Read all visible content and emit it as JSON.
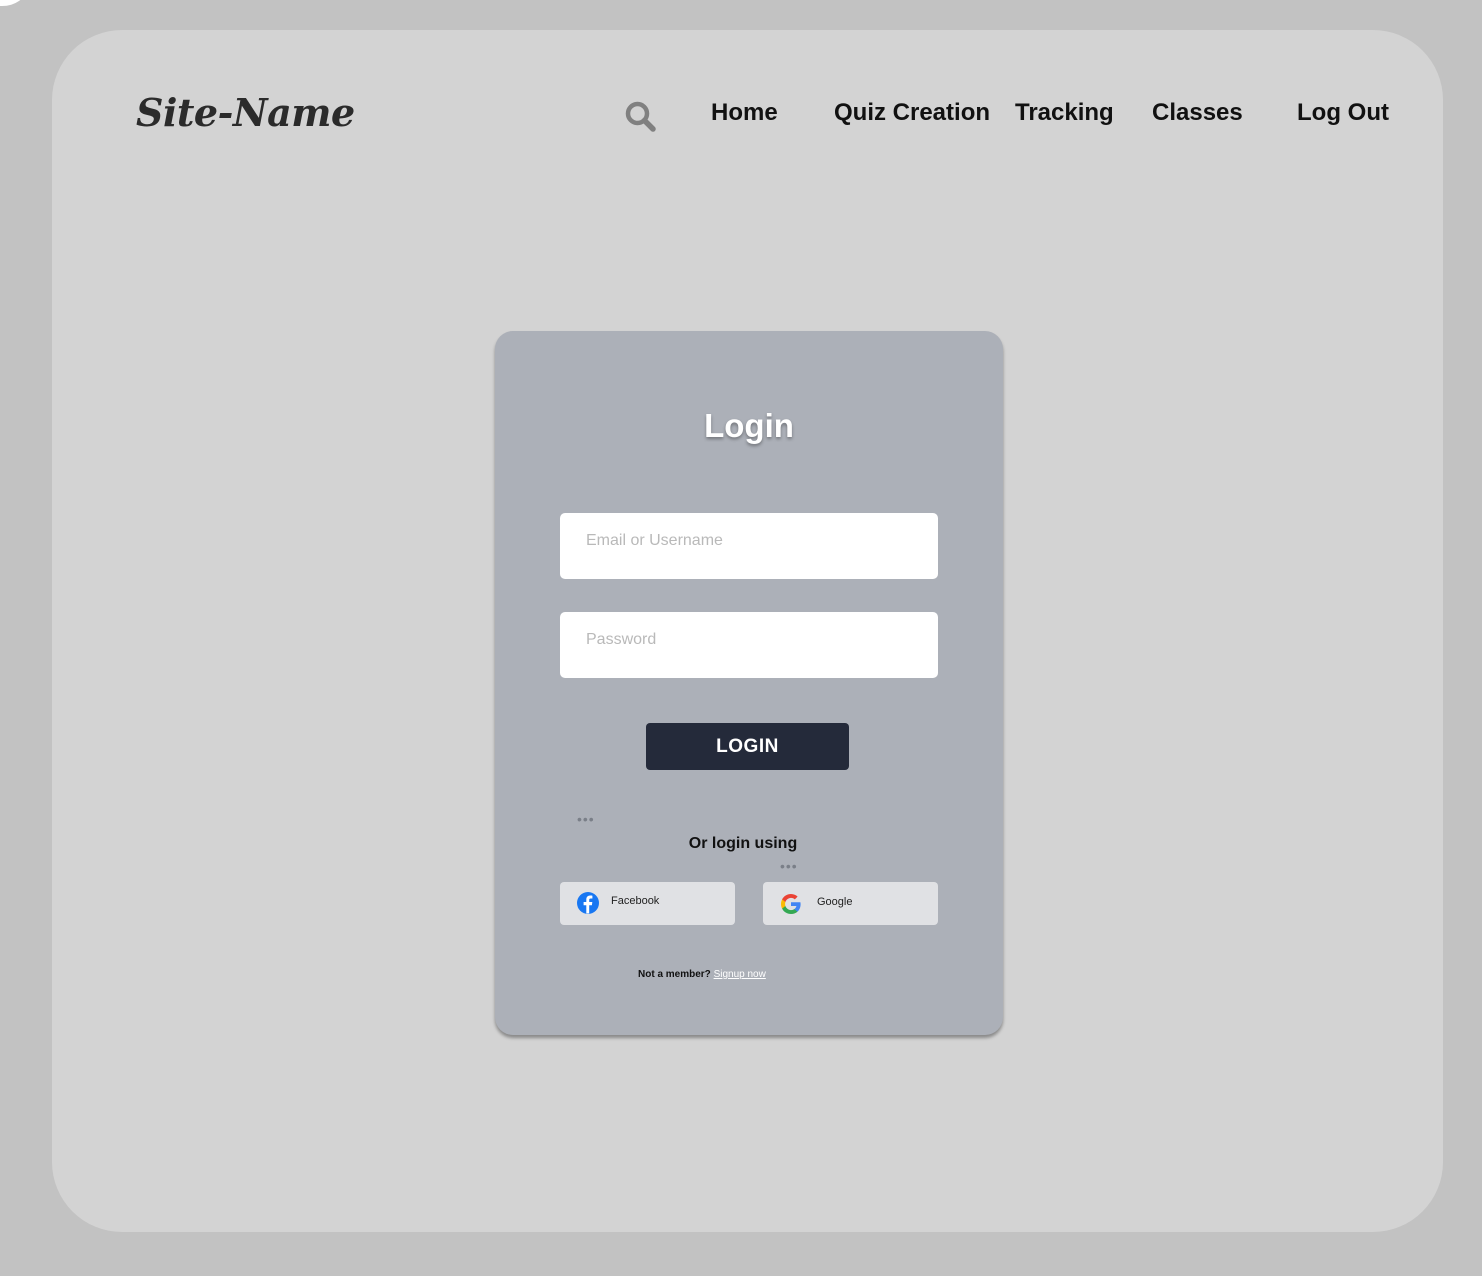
{
  "brand": {
    "name": "Site-Name"
  },
  "nav": {
    "items": [
      {
        "label": "Home"
      },
      {
        "label": "Quiz Creation"
      },
      {
        "label": "Tracking"
      },
      {
        "label": "Classes"
      },
      {
        "label": "Log Out"
      }
    ],
    "search_icon": "search-icon"
  },
  "login": {
    "title": "Login",
    "username_placeholder": "Email or Username",
    "password_placeholder": "Password",
    "button_label": "LOGIN",
    "alt_text": "Or login using",
    "social": [
      {
        "label": "Facebook",
        "icon": "facebook-icon"
      },
      {
        "label": "Google",
        "icon": "google-icon"
      }
    ],
    "signup_prompt": "Not a member?",
    "signup_link": "Signup now"
  },
  "colors": {
    "page_bg": "#c2c2c2",
    "frame_bg": "#d3d3d3",
    "card_bg": "#acb0b8",
    "button_bg": "#242a3a",
    "facebook_blue": "#1877f2"
  }
}
